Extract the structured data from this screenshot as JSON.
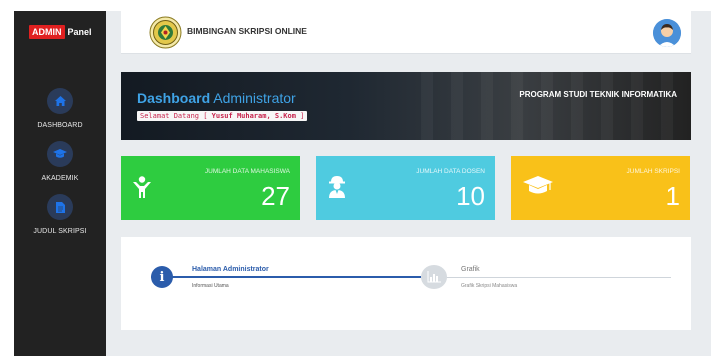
{
  "sidebar": {
    "brand_badge": "ADMIN",
    "brand_text": "Panel",
    "items": [
      {
        "label": "DASHBOARD",
        "icon": "home-icon"
      },
      {
        "label": "AKADEMIK",
        "icon": "graduation-cap-icon"
      },
      {
        "label": "JUDUL SKRIPSI",
        "icon": "document-icon"
      }
    ]
  },
  "header": {
    "app_title": "BIMBINGAN SKRIPSI ONLINE"
  },
  "banner": {
    "title_bold": "Dashboard",
    "title_rest": " Administrator",
    "welcome_prefix": "Selamat Datang [ ",
    "user_name": "Yusuf Muharam, S.Kom",
    "welcome_suffix": " ]",
    "program": "PROGRAM STUDI TEKNIK INFORMATIKA"
  },
  "stats": [
    {
      "label": "JUMLAH DATA MAHASISWA",
      "value": "27",
      "icon": "student-icon",
      "color": "#2ecc40"
    },
    {
      "label": "JUMLAH DATA DOSEN",
      "value": "10",
      "icon": "lecturer-icon",
      "color": "#4fcbe0"
    },
    {
      "label": "JUMLAH SKRIPSI",
      "value": "1",
      "icon": "graduation-cap-icon",
      "color": "#f9c119"
    }
  ],
  "steps": [
    {
      "title": "Halaman Administrator",
      "subtitle": "Informasi Utama",
      "icon": "info-icon"
    },
    {
      "title": "Grafik",
      "subtitle": "Grafik Skripsi Mahasiswa",
      "icon": "bar-chart-icon"
    }
  ],
  "colors": {
    "sidebar_bg": "#222222",
    "accent_blue": "#2b5cab",
    "admin_badge": "#e02020"
  }
}
